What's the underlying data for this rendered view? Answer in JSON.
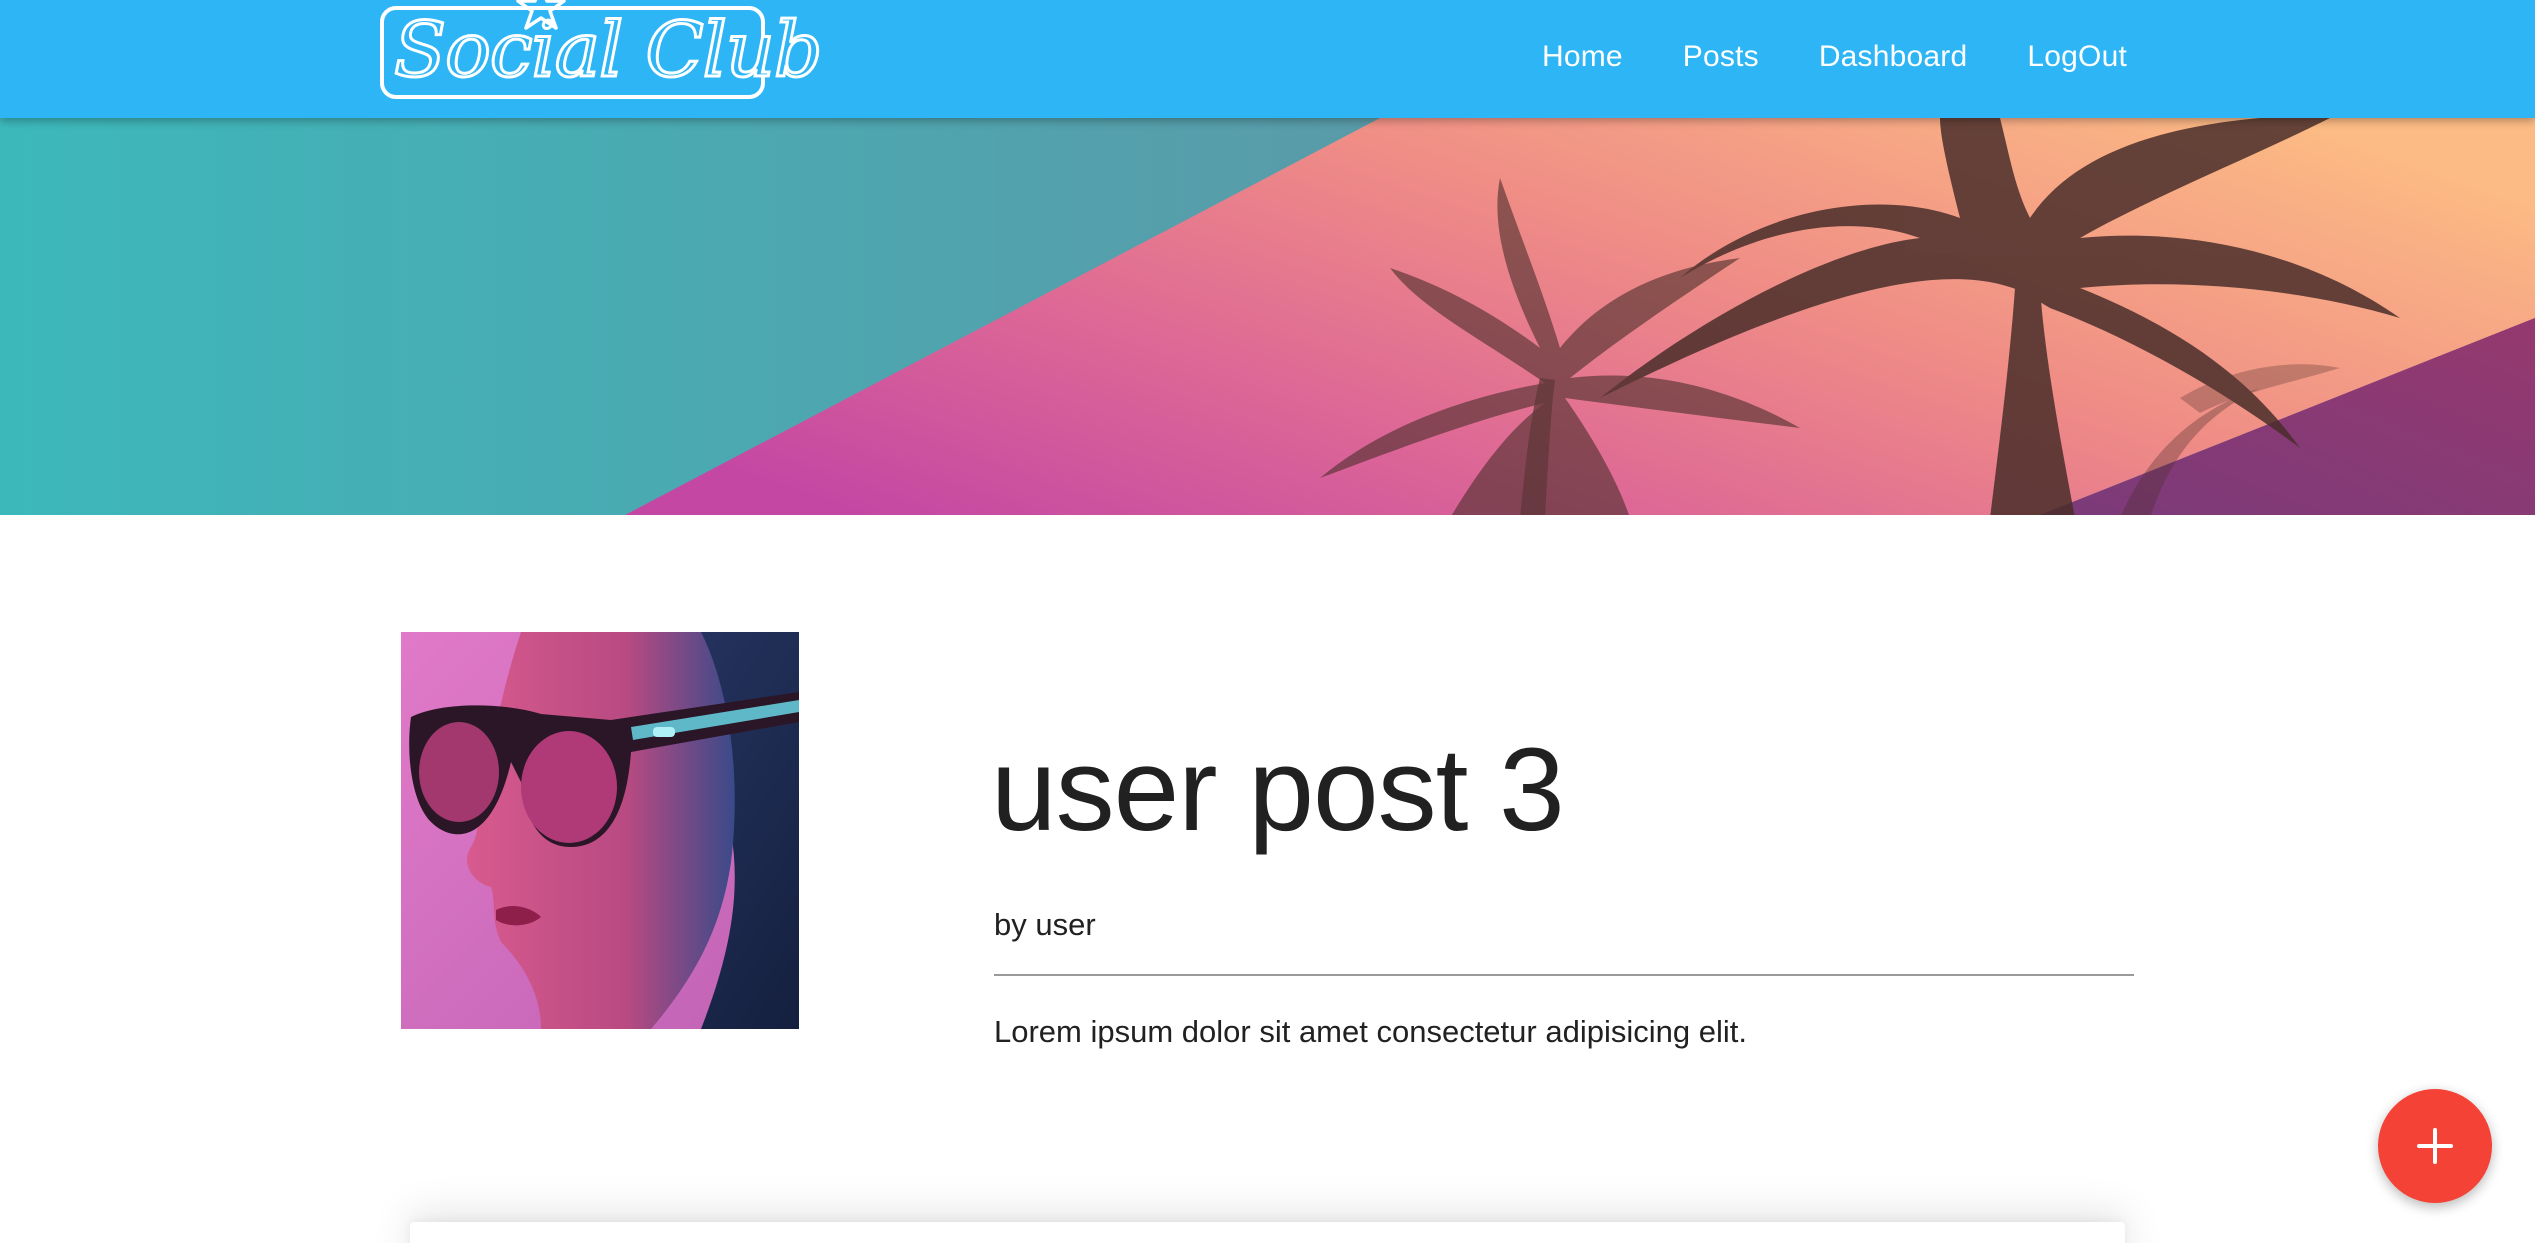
{
  "header": {
    "logo_text": "Social Club",
    "nav": [
      {
        "label": "Home"
      },
      {
        "label": "Posts"
      },
      {
        "label": "Dashboard"
      },
      {
        "label": "LogOut"
      }
    ],
    "bar_color": "#2db5f5"
  },
  "post": {
    "title": "user post 3",
    "author": "by user",
    "body": "Lorem ipsum dolor sit amet consectetur adipisicing elit."
  },
  "fab": {
    "icon": "plus-icon",
    "color": "#f44336"
  },
  "hero": {
    "colors": [
      "#3cb8bb",
      "#c84e9e",
      "#f08d86",
      "#fcb985",
      "#8f3f85"
    ]
  }
}
